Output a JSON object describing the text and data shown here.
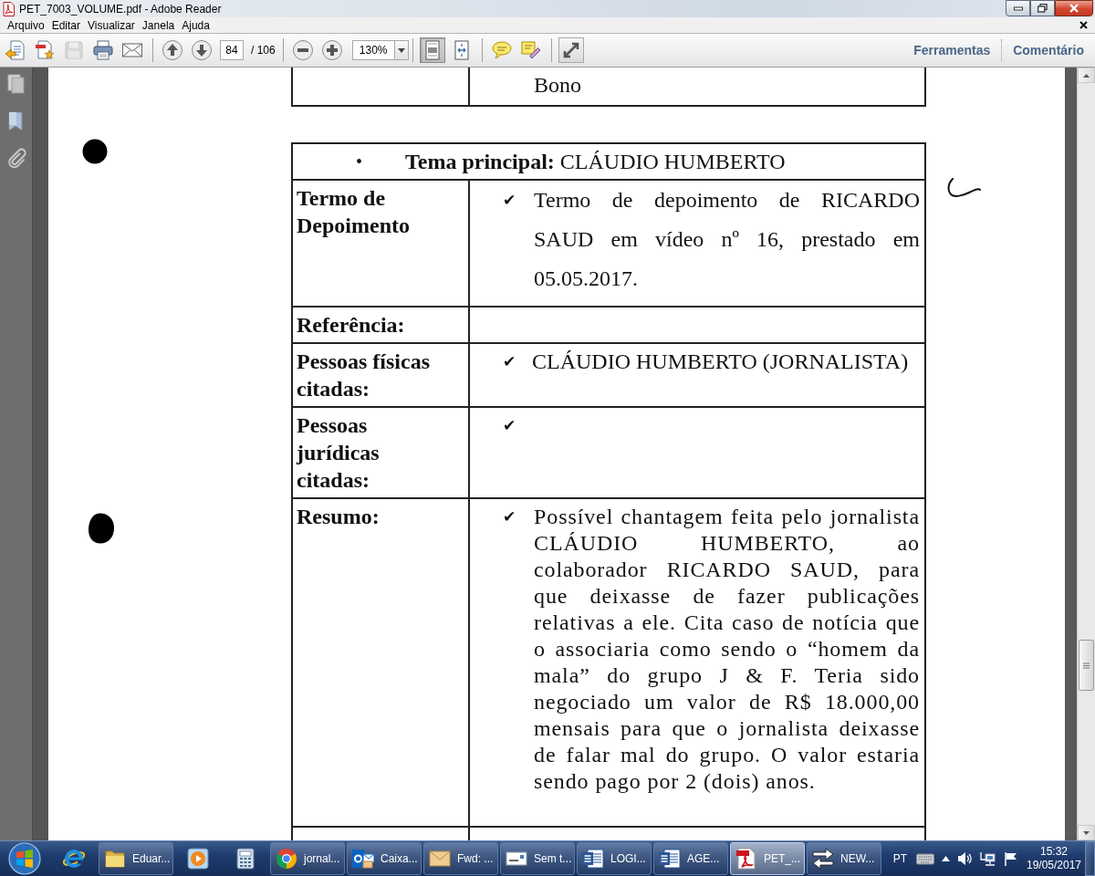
{
  "window": {
    "title": "PET_7003_VOLUME.pdf - Adobe Reader"
  },
  "menu": [
    "Arquivo",
    "Editar",
    "Visualizar",
    "Janela",
    "Ajuda"
  ],
  "toolbar": {
    "save": {
      "disabled": true
    },
    "page": {
      "value": "84"
    },
    "page_total": "/ 106",
    "zoom": {
      "value": "130%"
    },
    "view_modes": [
      {
        "selected": true
      },
      {
        "selected": false
      }
    ],
    "panes": [
      "Ferramentas",
      "Comentário"
    ]
  },
  "document": {
    "partial_cell": "Bono",
    "table": {
      "heading": {
        "bullet": "•",
        "text": "**Tema principal:** CLÁUDIO HUMBERTO"
      },
      "rows": [
        {
          "label": "Termo de Depoimento",
          "mark": "✔",
          "text": "Termo de depoimento de RICARDO SAUD em vídeo nº 16, prestado em 05.05.2017."
        },
        {
          "label": "Referência:"
        },
        {
          "label": "Pessoas físicas citadas:",
          "mark": "✔",
          "text": "CLÁUDIO HUMBERTO (JORNALISTA)"
        },
        {
          "label": "Pessoas jurídicas citadas:",
          "mark": "✔"
        },
        {
          "label": "Resumo:",
          "mark": "✔",
          "text": "Possível chantagem feita pelo jornalista CLÁUDIO HUMBERTO, ao colaborador RICARDO SAUD, para que deixasse de fazer publicações relativas a ele. Cita caso de notícia que o associaria como sendo o “homem da mala” do grupo J & F. Teria sido negociado um valor de R$ 18.000,00 mensais para que o jornalista deixasse de falar mal do grupo. O valor estaria sendo pago por 2 (dois) anos."
        }
      ]
    }
  },
  "taskbar": {
    "items": [
      {
        "kind": "pinned",
        "selected": false
      },
      {
        "kind": "window",
        "label": "Eduar...",
        "selected": false
      },
      {
        "kind": "pinned",
        "selected": false
      },
      {
        "kind": "pinned",
        "selected": false
      },
      {
        "kind": "window",
        "label": "jornal...",
        "selected": false
      },
      {
        "kind": "window",
        "label": "Caixa...",
        "selected": false
      },
      {
        "kind": "window",
        "label": "Fwd: ...",
        "selected": false
      },
      {
        "kind": "window",
        "label": "Sem t...",
        "selected": false
      },
      {
        "kind": "window",
        "label": "LOGI...",
        "selected": false
      },
      {
        "kind": "window",
        "label": "AGE...",
        "selected": false
      },
      {
        "kind": "window",
        "label": "PET_...",
        "selected": true
      },
      {
        "kind": "window",
        "label": "NEW...",
        "selected": false
      }
    ],
    "language": "PT",
    "time": "15:32",
    "date": "19/05/2017"
  }
}
